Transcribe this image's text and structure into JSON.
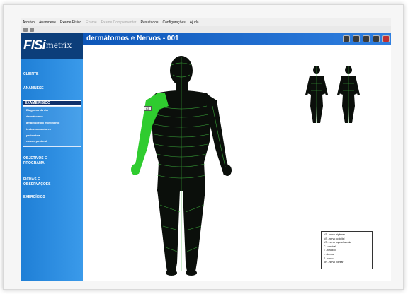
{
  "menu": {
    "items": [
      {
        "label": "Arquivo",
        "disabled": false
      },
      {
        "label": "Anamnese",
        "disabled": false
      },
      {
        "label": "Exame Físico",
        "disabled": false
      },
      {
        "label": "Exame",
        "disabled": true
      },
      {
        "label": "Exame Complementar",
        "disabled": true
      },
      {
        "label": "Resultados",
        "disabled": false
      },
      {
        "label": "Configurações",
        "disabled": false
      },
      {
        "label": "Ajuda",
        "disabled": false
      }
    ]
  },
  "logo": {
    "fisi": "FISi",
    "metrix": "metrix"
  },
  "sidebar": {
    "items": [
      {
        "label": "CLIENTE"
      },
      {
        "label": "ANAMNESE"
      },
      {
        "label": "EXAME FÍSICO"
      },
      {
        "label": "OBJETIVOS E"
      },
      {
        "label": "PROGRAMA"
      },
      {
        "label": "FICHAS E"
      },
      {
        "label": "OBSERVAÇÕES"
      },
      {
        "label": "EXERCÍCIOS"
      }
    ],
    "submenu": [
      {
        "label": "Diagrama da dor"
      },
      {
        "label": "dermátomos"
      },
      {
        "label": "amplitude do movimento"
      },
      {
        "label": "testes musculares"
      },
      {
        "label": "perimetria"
      },
      {
        "label": "exame postural"
      }
    ]
  },
  "window": {
    "title": "dermátomos e Nervos - 001"
  },
  "figure": {
    "tag": "C5"
  },
  "legend": {
    "rows": [
      "NT - nervo trigêmeo",
      "NS - nervo occipital",
      "NT - nervo supraclavicular",
      "C - cervical",
      "T - torácico",
      "L - lombar",
      "S - sacro",
      "NP - nervo plantar"
    ]
  },
  "colors": {
    "sidebar": "#2a8de0",
    "titlebar": "#1565c8",
    "body": "#0b0f0b",
    "highlight": "#4ee04e"
  }
}
